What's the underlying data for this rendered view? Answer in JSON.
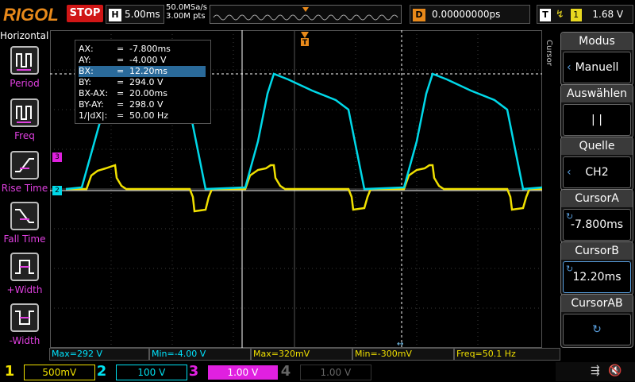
{
  "top": {
    "logo": "RIGOL",
    "run_state": "STOP",
    "h_label": "H",
    "timebase": "5.00ms",
    "sample_rate": "50.0MSa/s",
    "mem_depth": "3.00M pts",
    "d_label": "D",
    "delay": "0.00000000ps",
    "t_label": "T",
    "trigger_source": "1",
    "trigger_level": "1.68 V"
  },
  "left_menu": {
    "title": "Horizontal",
    "items": [
      {
        "label": "Period"
      },
      {
        "label": "Freq"
      },
      {
        "label": "Rise Time"
      },
      {
        "label": "Fall Time"
      },
      {
        "label": "+Width"
      },
      {
        "label": "-Width"
      }
    ]
  },
  "cursor_readout": {
    "rows": [
      {
        "name": "AX:",
        "eq": "=",
        "val": "-7.800ms"
      },
      {
        "name": "AY:",
        "eq": "=",
        "val": "-4.000 V"
      },
      {
        "name": "BX:",
        "eq": "=",
        "val": "12.20ms"
      },
      {
        "name": "BY:",
        "eq": "=",
        "val": "294.0 V"
      },
      {
        "name": "BX-AX:",
        "eq": "=",
        "val": "20.00ms"
      },
      {
        "name": "BY-AY:",
        "eq": "=",
        "val": "298.0 V"
      },
      {
        "name": "1/|dX|:",
        "eq": "=",
        "val": "50.00 Hz"
      }
    ]
  },
  "right_menu": {
    "side_label": "Cursor",
    "items": [
      {
        "head": "Modus",
        "value": "Manuell"
      },
      {
        "head": "Auswählen",
        "value": "|    |"
      },
      {
        "head": "Quelle",
        "value": "CH2"
      },
      {
        "head": "CursorA",
        "value": "-7.800ms"
      },
      {
        "head": "CursorB",
        "value": "12.20ms"
      },
      {
        "head": "CursorAB",
        "value": ""
      }
    ]
  },
  "measurements": [
    "Max=292 V",
    "Min=-4.00 V",
    "Max=320mV",
    "Min=-300mV",
    "Freq=50.1 Hz"
  ],
  "channels": [
    {
      "num": "1",
      "scale": "500mV",
      "color": "#f0e000"
    },
    {
      "num": "2",
      "scale": "100 V",
      "color": "#00e0f0"
    },
    {
      "num": "3",
      "scale": "1.00 V",
      "color": "#e020e0"
    },
    {
      "num": "4",
      "scale": "1.00 V",
      "color": "#444444"
    }
  ],
  "markers": {
    "ch3": "3",
    "ch2": "2",
    "trig_t": "T"
  },
  "colors": {
    "ch1": "#f0e000",
    "ch2": "#00d8e8",
    "ch3": "#e020e0",
    "accent": "#e8891a"
  }
}
